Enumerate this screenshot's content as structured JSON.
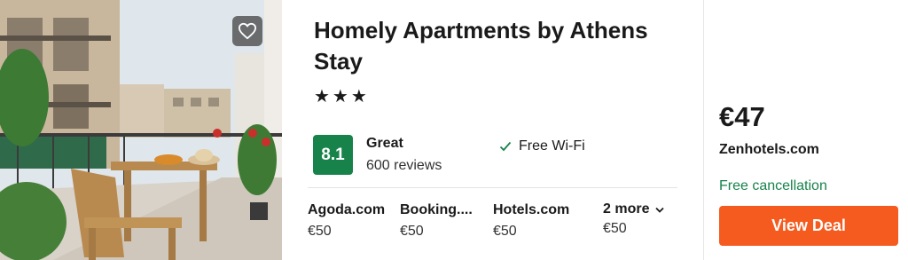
{
  "hotel": {
    "name": "Homely Apartments by Athens Stay",
    "stars": "★★★",
    "rating": {
      "score": "8.1",
      "label": "Great",
      "reviews": "600 reviews"
    },
    "amenities": [
      {
        "label": "Free Wi-Fi",
        "icon": "check-icon"
      }
    ]
  },
  "providers": [
    {
      "name": "Agoda.com",
      "price": "€50"
    },
    {
      "name": "Booking....",
      "price": "€50"
    },
    {
      "name": "Hotels.com",
      "price": "€50"
    }
  ],
  "more_providers": {
    "label": "2 more",
    "price": "€50",
    "icon": "chevron-down-icon"
  },
  "deal": {
    "price": "€47",
    "provider": "Zenhotels.com",
    "cancellation": "Free cancellation",
    "button_label": "View Deal"
  },
  "photo": {
    "favorite_icon": "heart-icon"
  },
  "colors": {
    "rating_badge": "#17834a",
    "free_cancellation": "#17834a",
    "deal_button": "#f55a1e"
  }
}
